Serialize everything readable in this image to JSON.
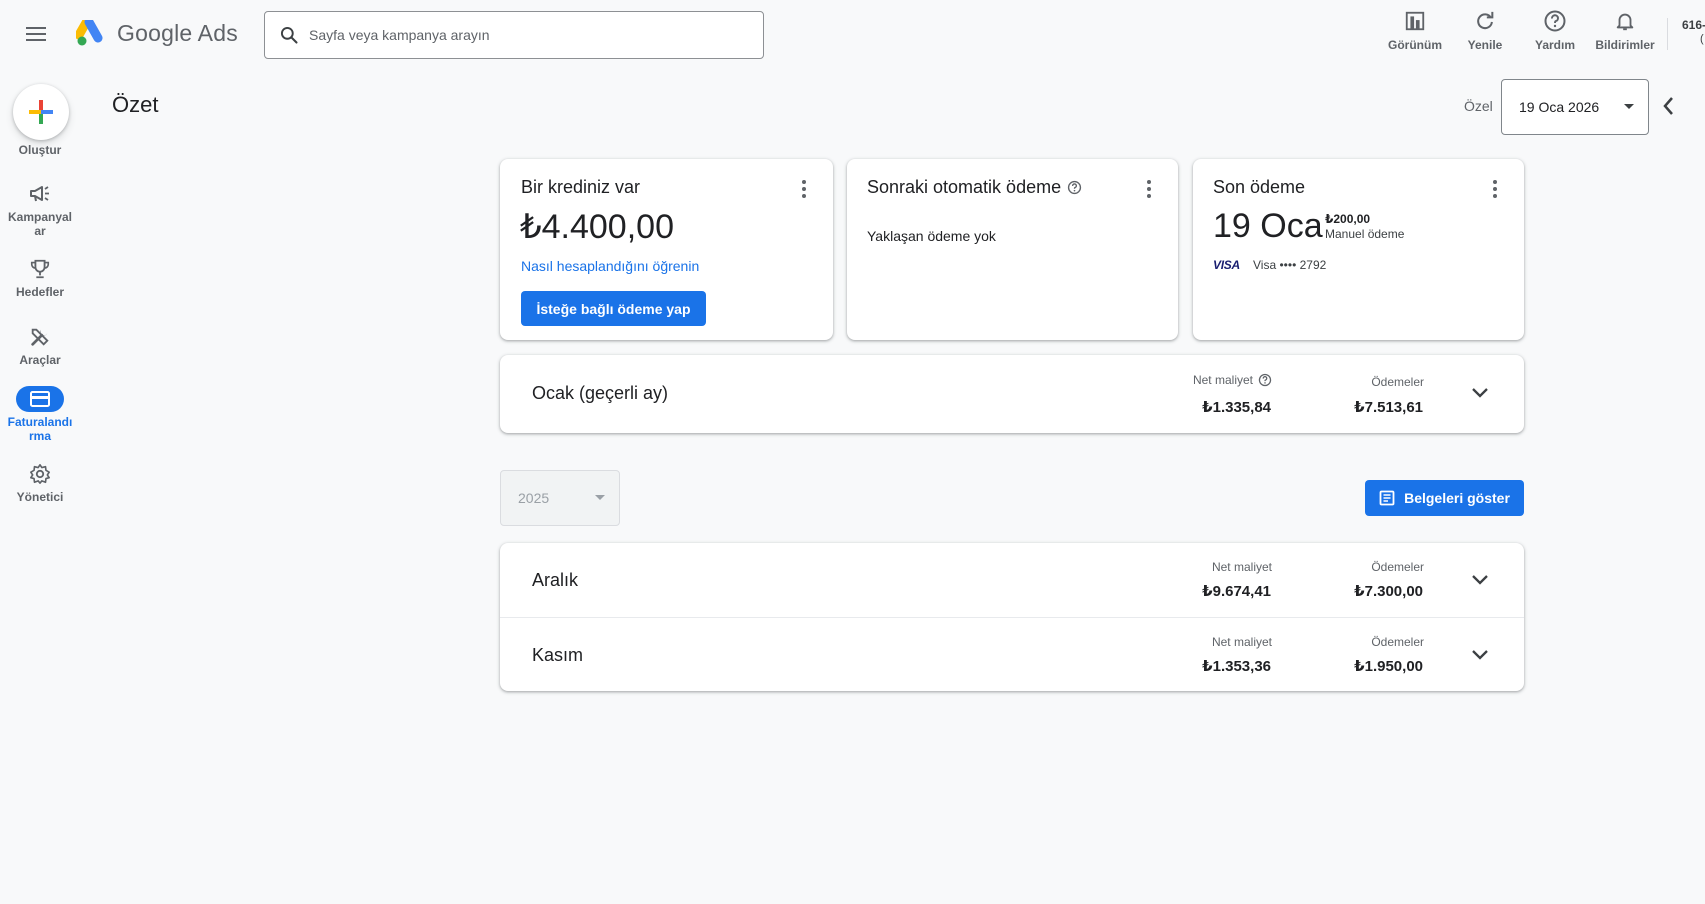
{
  "header": {
    "logo_text": "Google Ads",
    "search_placeholder": "Sayfa veya kampanya arayın",
    "actions": [
      {
        "label": "Görünüm",
        "icon": "view-icon"
      },
      {
        "label": "Yenile",
        "icon": "refresh-icon"
      },
      {
        "label": "Yardım",
        "icon": "help-icon"
      },
      {
        "label": "Bildirimler",
        "icon": "bell-icon"
      }
    ],
    "account_id": "616-",
    "account_sub": "("
  },
  "sidebar": {
    "create_label": "Oluştur",
    "items": [
      {
        "label": "Kampanyalar",
        "icon": "megaphone-icon",
        "active": false
      },
      {
        "label": "Hedefler",
        "icon": "trophy-icon",
        "active": false
      },
      {
        "label": "Araçlar",
        "icon": "tools-icon",
        "active": false
      },
      {
        "label": "Faturalandırma",
        "icon": "credit-card-icon",
        "active": true
      },
      {
        "label": "Yönetici",
        "icon": "gear-icon",
        "active": false
      }
    ]
  },
  "page": {
    "title": "Özet",
    "date_label": "Özel",
    "date_value": "19 Oca 2026"
  },
  "cards": {
    "credit": {
      "title": "Bir krediniz var",
      "amount": "₺4.400,00",
      "link": "Nasıl hesaplandığını öğrenin",
      "button": "İsteğe bağlı ödeme yap"
    },
    "next_payment": {
      "title": "Sonraki otomatik ödeme",
      "text": "Yaklaşan ödeme yok"
    },
    "last_payment": {
      "title": "Son ödeme",
      "date": "19 Oca",
      "amount": "₺200,00",
      "type": "Manuel ödeme",
      "card_brand": "VISA",
      "card_text": "Visa •••• 2792"
    }
  },
  "current_month": {
    "title": "Ocak (geçerli ay)",
    "net_cost_label": "Net maliyet",
    "net_cost": "₺1.335,84",
    "payments_label": "Ödemeler",
    "payments": "₺7.513,61"
  },
  "year_select": {
    "value": "2025"
  },
  "documents_button": "Belgeleri göster",
  "months": [
    {
      "title": "Aralık",
      "net_cost_label": "Net maliyet",
      "net_cost": "₺9.674,41",
      "payments_label": "Ödemeler",
      "payments": "₺7.300,00"
    },
    {
      "title": "Kasım",
      "net_cost_label": "Net maliyet",
      "net_cost": "₺1.353,36",
      "payments_label": "Ödemeler",
      "payments": "₺1.950,00"
    }
  ],
  "colors": {
    "primary": "#1a73e8",
    "background": "#f8f9fa",
    "text": "#202124",
    "secondary_text": "#5f6368",
    "visa_blue": "#1a1f71"
  }
}
